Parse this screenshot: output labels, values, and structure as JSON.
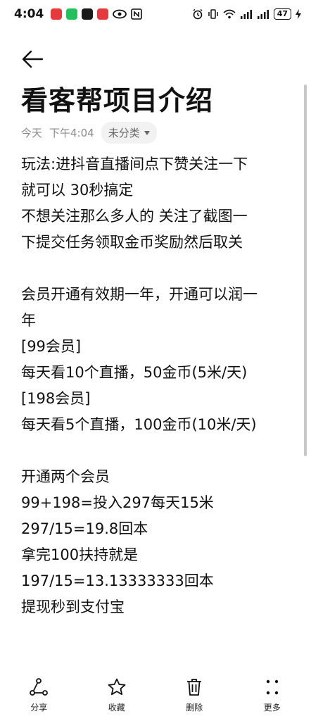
{
  "status_bar": {
    "time": "4:04",
    "battery": "47",
    "app_icons": [
      "red-app-icon",
      "wechat-icon",
      "tiktok-icon",
      "red-app-icon"
    ]
  },
  "note": {
    "title": "看客帮项目介绍",
    "date": "今天",
    "time": "下午4:04",
    "category": "未分类",
    "lines": [
      "玩法:进抖音直播间点下赞关注一下",
      "就可以 30秒搞定",
      "不想关注那么多人的 关注了截图一",
      "下提交任务领取金币奖励然后取关",
      "",
      "会员开通有效期一年，开通可以润一",
      "年",
      "[99会员]",
      "每天看10个直播，50金币(5米/天)",
      "[198会员]",
      "每天看5个直播，100金币(10米/天)",
      "",
      "开通两个会员",
      "99+198=投入297每天15米",
      "297/15=19.8回本",
      "拿完100扶持就是",
      "197/15=13.13333333回本",
      "提现秒到支付宝"
    ]
  },
  "toolbar": {
    "share": "分享",
    "favorite": "收藏",
    "delete": "删除",
    "more": "更多"
  }
}
